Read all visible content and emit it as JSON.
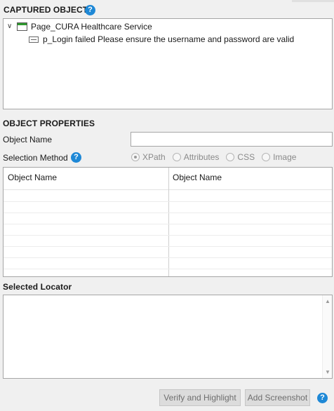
{
  "captured_objects": {
    "title": "CAPTURED OBJECTS",
    "help_icon": "help-icon",
    "tree": [
      {
        "label": "Page_CURA Healthcare Service",
        "icon": "page-icon",
        "expanded": true
      },
      {
        "label": "p_Login failed Please ensure the username and password are valid",
        "icon": "element-icon"
      }
    ]
  },
  "object_properties": {
    "title": "OBJECT PROPERTIES",
    "object_name_label": "Object Name",
    "object_name_value": "",
    "selection_method_label": "Selection Method",
    "selection_options": [
      "XPath",
      "Attributes",
      "CSS",
      "Image"
    ],
    "selected_option": "XPath",
    "grid_headers": [
      "Object Name",
      "Object Name"
    ]
  },
  "selected_locator": {
    "title": "Selected Locator",
    "value": ""
  },
  "buttons": {
    "verify": "Verify and Highlight",
    "screenshot": "Add Screenshot"
  },
  "colors": {
    "help_icon": "#1e88d6",
    "page_icon_bar": "#2e9a2e"
  }
}
